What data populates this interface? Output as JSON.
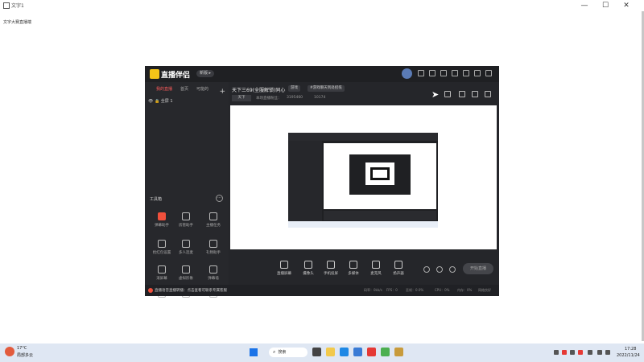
{
  "outer_window": {
    "title": "文字1",
    "subtitle": "文字大赛直播端",
    "controls": {
      "minimize": "—",
      "maximize": "☐",
      "close": "✕"
    }
  },
  "app": {
    "logo_text": "直播伴侣",
    "version_pill": "新版 ▸",
    "tabs": [
      "我的直播",
      "首页",
      "可能的"
    ],
    "add_label": "+",
    "scene_label": "全屏 1",
    "stream_title": "天下三69(全服解锁)同心",
    "chips": [
      "游戏",
      "#游戏聊天到处招揽"
    ],
    "tag_chip": "天下",
    "meta": {
      "label": "本场直播粉丝：",
      "count1": "3195460",
      "count2": "10174"
    },
    "tools_title": "工具箱",
    "more_label": "···",
    "tools": [
      {
        "label": "弹幕助手",
        "icon": "danmaku-icon"
      },
      {
        "label": "房管助手",
        "icon": "user-icon"
      },
      {
        "label": "主播任务",
        "icon": "task-icon"
      },
      {
        "label": "抢红包设置",
        "icon": "gift-icon"
      },
      {
        "label": "多人连麦",
        "icon": "download-icon"
      },
      {
        "label": "礼物助手",
        "icon": "screen-icon"
      },
      {
        "label": "滚屏幕",
        "icon": "scroll-icon"
      },
      {
        "label": "虚拟形象",
        "icon": "download-icon"
      },
      {
        "label": "弹幕墙",
        "icon": "calendar-icon"
      },
      {
        "label": "",
        "icon": "book-icon"
      },
      {
        "label": "",
        "icon": "gamepad-icon"
      },
      {
        "label": "",
        "icon": "more-icon"
      }
    ],
    "bottom_buttons": [
      {
        "label": "直播屏幕",
        "icon": "monitor-icon"
      },
      {
        "label": "摄像头",
        "icon": "camera-icon"
      },
      {
        "label": "手机投屏",
        "icon": "phone-icon"
      },
      {
        "label": "多媒体",
        "icon": "media-icon"
      },
      {
        "label": "麦克风",
        "icon": "mic-icon"
      },
      {
        "label": "扬声器",
        "icon": "speaker-icon"
      }
    ],
    "start_label": "开始直播",
    "footer_msg": "直播语音直播转播：点击查看可联系专属客服",
    "footer_stats": [
      "码率：0kb/s",
      "FPS：0",
      "丢帧：0.0%",
      "CPU：0%",
      "内存：0%",
      "网络良好"
    ]
  },
  "taskbar": {
    "weather_temp": "17°C",
    "weather_desc": "局部多云",
    "search_label": "搜索",
    "clock_time": "17:28",
    "clock_date": "2022/11/24"
  }
}
